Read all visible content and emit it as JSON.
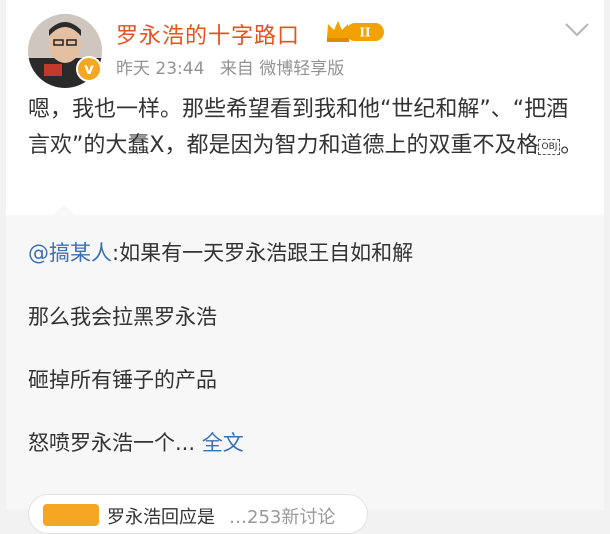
{
  "post": {
    "username": "罗永浩的十字路口",
    "badge_level": "II",
    "time": "昨天 23:44",
    "source": "来自 微博轻享版",
    "text": "嗯，我也一样。那些希望看到我和他“世纪和解”、“把酒言欢”的大蠢X，都是因为智力和道德上的双重不及格",
    "obj_placeholder": "OBJ",
    "text_end": "。"
  },
  "repost": {
    "mention": "@搞某人",
    "line1": ":如果有一天罗永浩跟王自如和解",
    "line2": "那么我会拉黑罗永浩",
    "line3": "砸掉所有锤子的产品",
    "line4": "怒喷罗永浩一个...",
    "full_text": "全文"
  },
  "topic": {
    "label": "罗永浩回应是",
    "sub": "…253新讨论"
  },
  "colors": {
    "accent_orange": "#e8521d",
    "link_blue": "#3b6fb6",
    "gold": "#f5a623"
  }
}
